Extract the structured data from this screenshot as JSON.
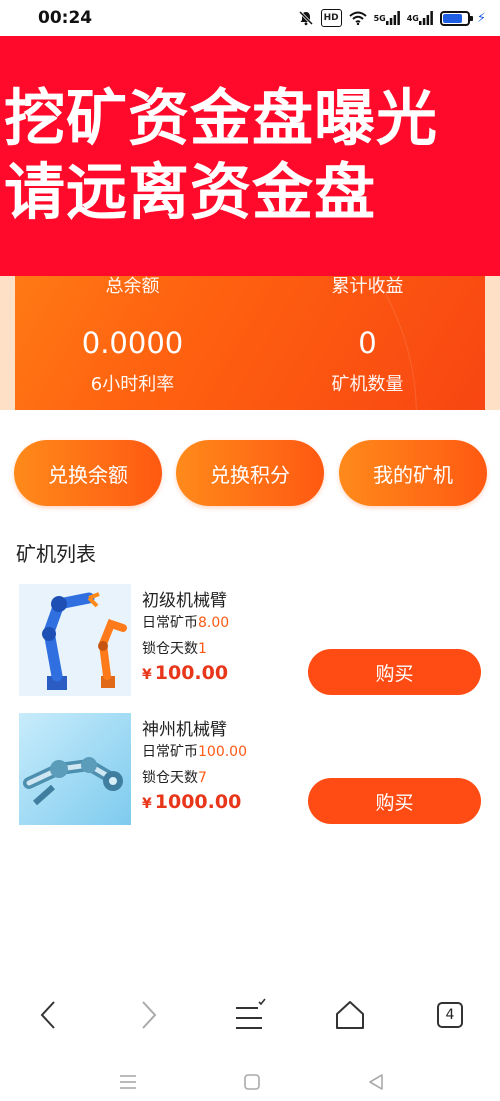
{
  "status_bar": {
    "time": "00:24",
    "icons": [
      "mute-icon",
      "hd-icon",
      "wifi-icon",
      "signal-5g-icon",
      "signal-4g-icon",
      "battery-icon",
      "charging-icon"
    ],
    "hd_label": "HD",
    "net1": "5G",
    "net2": "4G"
  },
  "warning_banner": {
    "line1": "挖矿资金盘曝光",
    "line2": "请远离资金盘",
    "color": "#ff0a2a"
  },
  "stats": {
    "total_balance_label": "总余额",
    "total_earnings_label": "累计收益",
    "rate_value": "0.0000",
    "rate_label": "6小时利率",
    "miner_count_value": "0",
    "miner_count_label": "矿机数量"
  },
  "actions": {
    "exchange_balance": "兑换余额",
    "exchange_points": "兑换积分",
    "my_miners": "我的矿机"
  },
  "section_title": "矿机列表",
  "products": [
    {
      "name": "初级机械臂",
      "daily_label": "日常矿币",
      "daily_value": "8.00",
      "lock_label": "锁仓天数",
      "lock_value": "1",
      "currency": "¥",
      "price": "100.00",
      "buy_label": "购买"
    },
    {
      "name": "神州机械臂",
      "daily_label": "日常矿币",
      "daily_value": "100.00",
      "lock_label": "锁仓天数",
      "lock_value": "7",
      "currency": "¥",
      "price": "1000.00",
      "buy_label": "购买"
    }
  ],
  "browser_nav": {
    "tab_count": "4"
  },
  "colors": {
    "accent": "#ff5a14",
    "price": "#e8361a"
  }
}
